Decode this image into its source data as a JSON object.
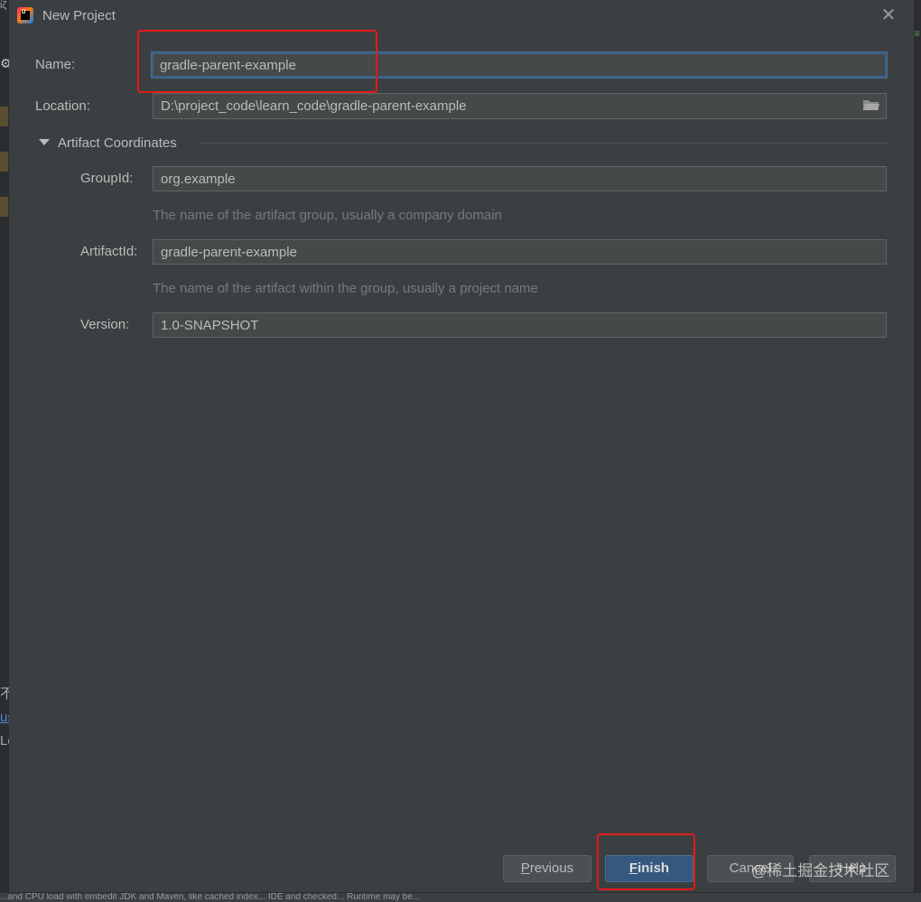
{
  "window": {
    "title": "New Project",
    "logo_text": "IJ"
  },
  "form": {
    "name": {
      "label": "Name:",
      "value": "gradle-parent-example"
    },
    "location": {
      "label": "Location:",
      "value": "D:\\project_code\\learn_code\\gradle-parent-example"
    },
    "artifact_section": {
      "title": "Artifact Coordinates",
      "expanded": true
    },
    "group_id": {
      "label": "GroupId:",
      "value": "org.example",
      "hint": "The name of the artifact group, usually a company domain"
    },
    "artifact_id": {
      "label": "ArtifactId:",
      "value": "gradle-parent-example",
      "hint": "The name of the artifact within the group, usually a project name"
    },
    "version": {
      "label": "Version:",
      "value": "1.0-SNAPSHOT"
    }
  },
  "buttons": {
    "previous": {
      "mnemonic": "P",
      "rest": "revious"
    },
    "finish": {
      "mnemonic": "F",
      "rest": "inish"
    },
    "cancel": "Cancel",
    "help": "Help"
  },
  "watermark": "@稀土掘金技术社区",
  "background": {
    "left_fragments": [
      "ίζ",
      "不",
      "us",
      "Le"
    ],
    "status_text": "...and CPU load with embedit JDK and Maven, like cached index... IDE and checked... Runtime may be..."
  },
  "colors": {
    "dialog_bg": "#3c3f41",
    "field_bg": "#45494a",
    "default_button": "#365880",
    "annotation_red": "#e11b1b"
  },
  "icons": {
    "app": "intellij-logo-icon",
    "close": "close-icon",
    "folder": "folder-icon",
    "section_toggle": "triangle-down-icon",
    "settings": "gear-icon"
  }
}
